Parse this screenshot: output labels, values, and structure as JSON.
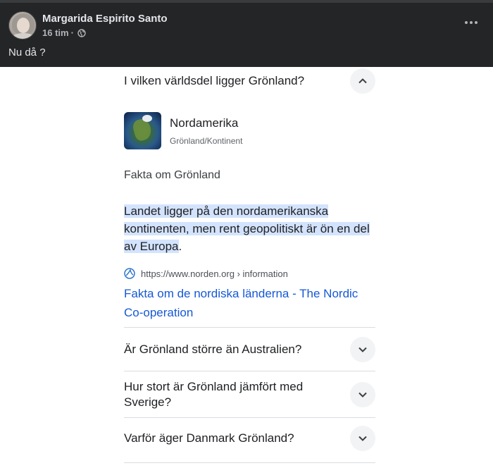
{
  "post": {
    "author": "Margarida Espirito Santo",
    "time": "16 tim",
    "separator": "·",
    "text": "Nu då ?"
  },
  "panel": {
    "open_question": "I vilken världsdel ligger Grönland?",
    "entity": {
      "title": "Nordamerika",
      "subtitle": "Grönland/Kontinent"
    },
    "fakta_heading": "Fakta om Grönland",
    "answer_highlighted": "Landet ligger på den nordamerikanska kontinenten, men rent geopolitiskt är ön en del av Europa",
    "answer_tail": ".",
    "source_url": "https://www.norden.org › information",
    "source_title": "Fakta om de nordiska länderna - The Nordic Co-operation",
    "questions": [
      "Är Grönland större än Australien?",
      "Hur stort är Grönland jämfört med Sverige?",
      "Varför äger Danmark Grönland?"
    ]
  },
  "colors": {
    "header_bg": "#242526",
    "highlight": "#d3e3fd",
    "link": "#1558d6"
  }
}
